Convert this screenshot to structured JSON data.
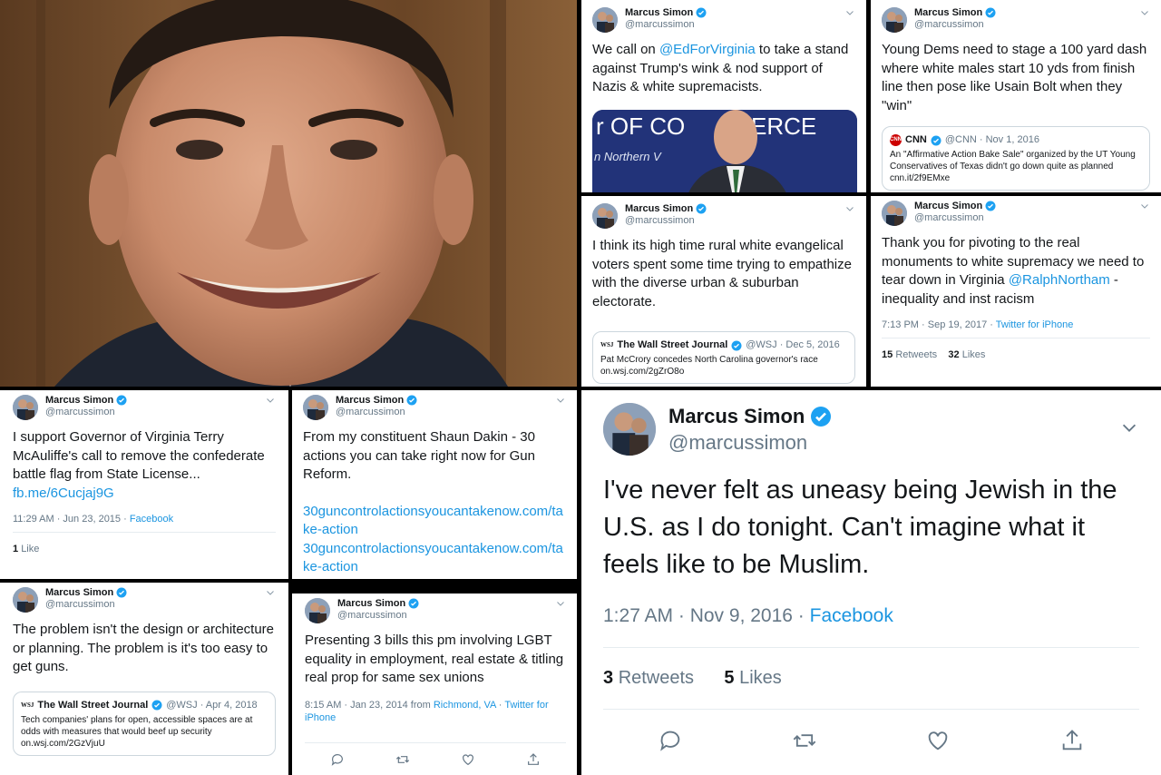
{
  "author": {
    "name": "Marcus Simon",
    "handle": "@marcussimon"
  },
  "tweets": {
    "t1": {
      "text_pre": "We call on ",
      "mention": "@EdForVirginia",
      "text_post": " to take a stand against Trump's wink & nod support of Nazis & white supremacists.",
      "image_text1": "r OF CO",
      "image_text2": "ERCE",
      "image_text3": "n Northern V"
    },
    "t2": {
      "text": "Young Dems need to stage a 100 yard dash where white males start 10 yds from finish line then pose like Usain Bolt when they \"win\"",
      "quote": {
        "logo": "CNN",
        "name": "CNN",
        "handle": "@CNN · Nov 1, 2016",
        "text": "An \"Affirmative Action Bake Sale\" organized by the UT Young Conservatives of Texas didn't go down quite as planned cnn.it/2f9EMxe"
      }
    },
    "t3": {
      "text": "I think its high time rural white evangelical voters spent some time trying to empathize with the diverse urban & suburban electorate.",
      "quote": {
        "logo": "WSJ",
        "name": "The Wall Street Journal",
        "handle": "@WSJ · Dec 5, 2016",
        "text": "Pat McCrory concedes North Carolina governor's race on.wsj.com/2gZrO8o"
      }
    },
    "t4": {
      "text_pre": "Thank you for pivoting to the real monuments to white supremacy we need to tear down in Virginia ",
      "mention": "@RalphNortham",
      "text_post": " - inequality and inst racism",
      "time": "7:13 PM · Sep 19, 2017 · ",
      "source": "Twitter for iPhone",
      "retweets_n": "15",
      "retweets_l": "Retweets",
      "likes_n": "32",
      "likes_l": "Likes"
    },
    "t5": {
      "text": "I support Governor of Virginia Terry McAuliffe's call to remove the confederate battle flag from State License...",
      "link": "fb.me/6Cucjaj9G",
      "time": "11:29 AM · Jun 23, 2015 · ",
      "source": "Facebook",
      "likes_n": "1",
      "likes_l": "Like"
    },
    "t6": {
      "text": "From my constituent Shaun Dakin - 30 actions you can take right now for Gun Reform.",
      "link1": "30guncontrolactionsyoucantakenow.com/take-action",
      "link2": "30guncontrolactionsyoucantakenow.com/take-action"
    },
    "t7": {
      "text": "I've never felt as uneasy being Jewish in the U.S. as I do tonight. Can't imagine what it feels like to be Muslim.",
      "time": "1:27 AM · Nov 9, 2016 · ",
      "source": "Facebook",
      "retweets_n": "3",
      "retweets_l": "Retweets",
      "likes_n": "5",
      "likes_l": "Likes"
    },
    "t8": {
      "text": "The problem isn't the design or architecture or planning. The problem is it's too easy to get guns.",
      "quote": {
        "logo": "WSJ",
        "name": "The Wall Street Journal",
        "handle": "@WSJ · Apr 4, 2018",
        "text": "Tech companies' plans for open, accessible spaces are at odds with measures that would beef up security on.wsj.com/2GzVjuU"
      }
    },
    "t9": {
      "text": "Presenting 3 bills this pm involving LGBT equality in employment, real estate & titling real prop for same sex unions",
      "time": "8:15 AM · Jan 23, 2014 from ",
      "location": "Richmond, VA",
      "sep": " · ",
      "source": "Twitter for iPhone"
    }
  },
  "icons": [
    "verified-badge-icon",
    "chevron-down-icon",
    "reply-icon",
    "retweet-icon",
    "like-icon",
    "share-icon"
  ],
  "colors": {
    "link": "#1b95e0",
    "verified": "#1da1f2",
    "muted": "#657786",
    "text": "#14171a"
  }
}
